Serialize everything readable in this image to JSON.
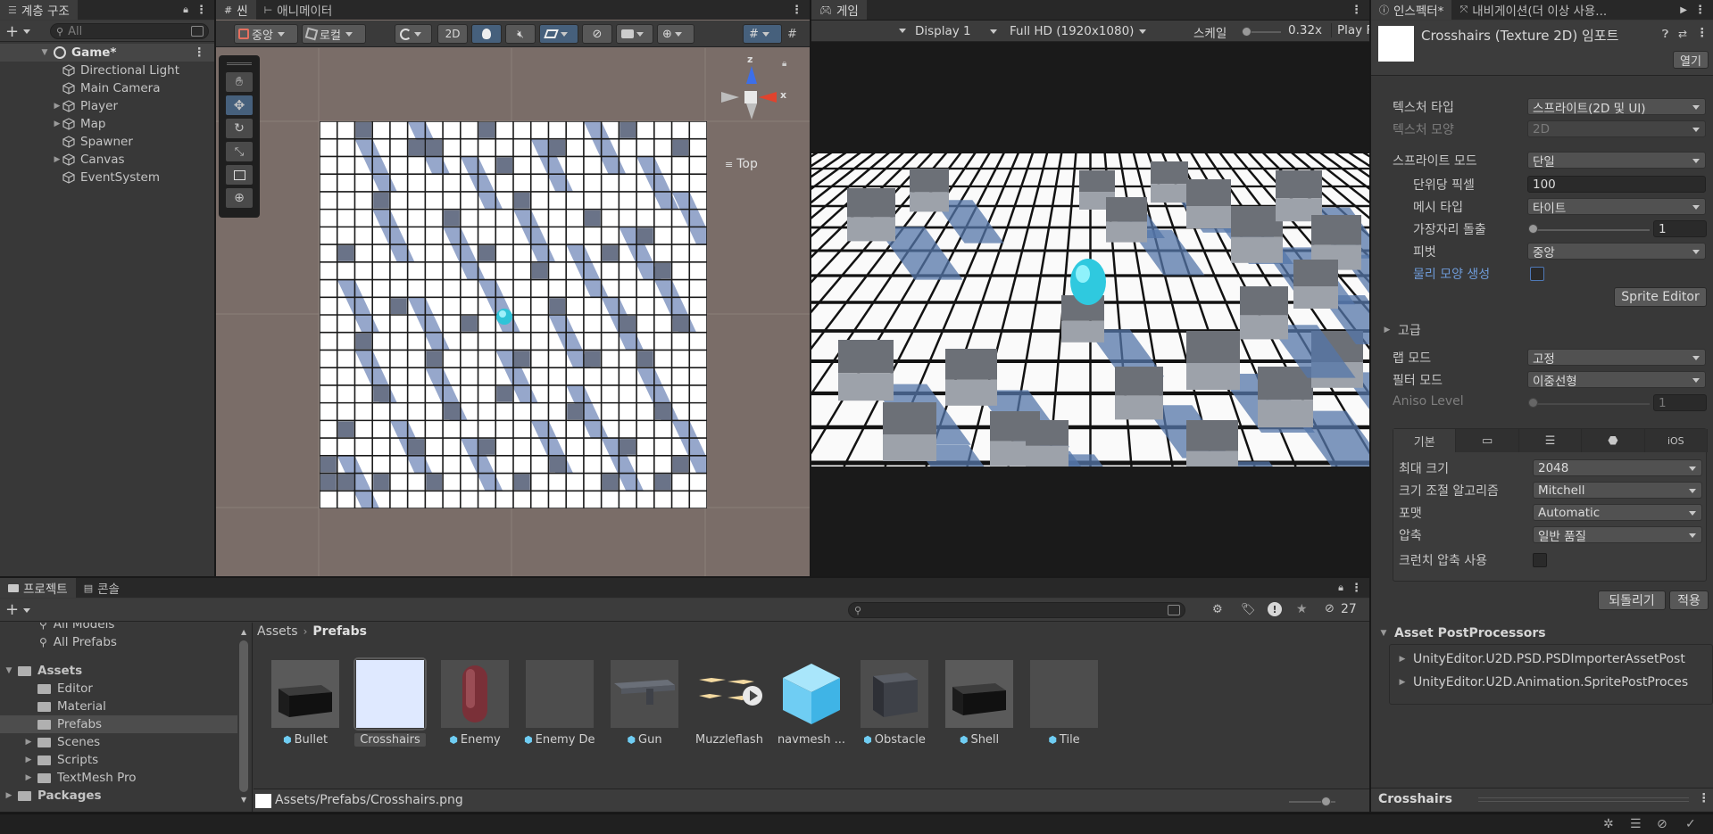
{
  "hierarchy": {
    "tab_label": "계층 구조",
    "search_placeholder": "All",
    "scene_name": "Game*",
    "items": [
      {
        "label": "Directional Light",
        "expandable": false
      },
      {
        "label": "Main Camera",
        "expandable": false
      },
      {
        "label": "Player",
        "expandable": true
      },
      {
        "label": "Map",
        "expandable": true
      },
      {
        "label": "Spawner",
        "expandable": false
      },
      {
        "label": "Canvas",
        "expandable": true
      },
      {
        "label": "EventSystem",
        "expandable": false
      }
    ]
  },
  "scene": {
    "tabs": [
      "씬",
      "애니메이터"
    ],
    "toolbar": {
      "pivot_label": "중앙",
      "space_label": "로컬",
      "mode_2d_label": "2D"
    },
    "gizmo": {
      "axis_z": "z",
      "axis_x": "x",
      "view_label": "Top"
    }
  },
  "game": {
    "tab_label": "게임",
    "display_label": "Display 1",
    "resolution_label": "Full HD (1920x1080)",
    "scale_label": "스케일",
    "scale_value": "0.32x",
    "play_label": "Play F"
  },
  "inspector": {
    "tabs": [
      "인스펙터*",
      "내비게이션(더 이상 사용..."
    ],
    "title": "Crosshairs (Texture 2D) 임포트",
    "open_button": "열기",
    "props": [
      {
        "label": "텍스처 타입",
        "value": "스프라이트(2D 및 UI)",
        "disabled": false,
        "indent": false
      },
      {
        "label": "텍스처 모양",
        "value": "2D",
        "disabled": true,
        "indent": false
      },
      {
        "label": "스프라이트 모드",
        "value": "단일",
        "disabled": false,
        "indent": false
      },
      {
        "label": "단위당 픽셀",
        "value": "100",
        "disabled": false,
        "indent": true
      },
      {
        "label": "메시 타입",
        "value": "타이트",
        "disabled": false,
        "indent": true
      },
      {
        "label": "가장자리 돌출",
        "value": "1",
        "disabled": false,
        "indent": true
      },
      {
        "label": "피벗",
        "value": "중앙",
        "disabled": false,
        "indent": true
      },
      {
        "label": "물리 모양 생성",
        "value": "",
        "disabled": false,
        "indent": true
      }
    ],
    "extrude_level": 0.0,
    "sprite_editor_button": "Sprite Editor",
    "advanced_label": "고급",
    "wrap_mode_label": "랩 모드",
    "wrap_mode_value": "고정",
    "filter_mode_label": "필터 모드",
    "filter_mode_value": "이중선형",
    "aniso_label": "Aniso Level",
    "aniso_value": "1",
    "platform_tabs": [
      "기본",
      "monitor-icon",
      "layers-icon",
      "android-icon",
      "iOS"
    ],
    "platform_props": [
      {
        "label": "최대 크기",
        "value": "2048"
      },
      {
        "label": "크기 조절 알고리즘",
        "value": "Mitchell"
      },
      {
        "label": "포맷",
        "value": "Automatic"
      },
      {
        "label": "압축",
        "value": "일반 품질"
      }
    ],
    "crunch_label": "크런치 압축 사용",
    "revert_button": "되돌리기",
    "apply_button": "적용",
    "postprocessors_label": "Asset PostProcessors",
    "postprocessors": [
      "UnityEditor.U2D.PSD.PSDImporterAssetPost",
      "UnityEditor.U2D.Animation.SpritePostProces"
    ],
    "preview_label": "Crosshairs"
  },
  "project": {
    "tabs": [
      "프로젝트",
      "콘솔"
    ],
    "hidden_count": "27",
    "tree": [
      {
        "label": "All Models",
        "level": 1,
        "folder": false
      },
      {
        "label": "All Prefabs",
        "level": 1,
        "folder": false
      },
      {
        "label": "Assets",
        "level": 0,
        "folder": true
      },
      {
        "label": "Editor",
        "level": 1,
        "folder": true
      },
      {
        "label": "Material",
        "level": 1,
        "folder": true
      },
      {
        "label": "Prefabs",
        "level": 1,
        "folder": true
      },
      {
        "label": "Scenes",
        "level": 1,
        "folder": true
      },
      {
        "label": "Scripts",
        "level": 1,
        "folder": true
      },
      {
        "label": "TextMesh Pro",
        "level": 1,
        "folder": true
      },
      {
        "label": "Packages",
        "level": 0,
        "folder": true
      }
    ],
    "breadcrumb": [
      "Assets",
      "Prefabs"
    ],
    "assets": [
      {
        "name": "Bullet",
        "prefab": true
      },
      {
        "name": "Crosshairs",
        "prefab": false
      },
      {
        "name": "Enemy",
        "prefab": true
      },
      {
        "name": "Enemy De...",
        "prefab": true
      },
      {
        "name": "Gun",
        "prefab": true
      },
      {
        "name": "Muzzleflash",
        "prefab": false
      },
      {
        "name": "navmesh ...",
        "prefab": false
      },
      {
        "name": "Obstacle",
        "prefab": true
      },
      {
        "name": "Shell",
        "prefab": true
      },
      {
        "name": "Tile",
        "prefab": true
      }
    ],
    "status_path": "Assets/Prefabs/Crosshairs.png"
  },
  "colors": {
    "accent": "#2c5d87",
    "selection": "#2c5d87",
    "panel": "#383838",
    "tab_bar": "#282828",
    "link_blue": "#6e9bd8",
    "crosshair_thumb": "#dfe9ff",
    "navmesh_cyan": "#6fcdf3"
  }
}
